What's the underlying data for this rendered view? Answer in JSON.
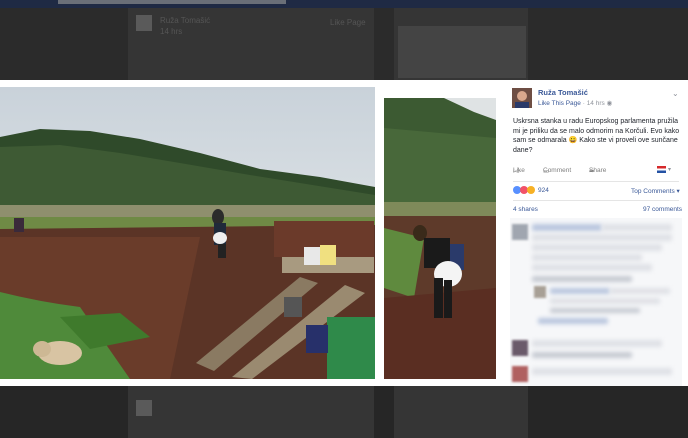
{
  "background": {
    "post_author": "Ruža Tomašić",
    "post_action": "Like Page",
    "post_time": "14 hrs"
  },
  "post": {
    "author": "Ruža Tomašić",
    "like_page": "Like This Page",
    "time": "14 hrs",
    "text": "Uskrsna stanka u radu Europskog parlamenta pružila mi je priliku da se malo odmorim na Korčuli. Evo kako sam se odmarala 😀 Kako ste vi proveli ove sunčane dane?",
    "actions": {
      "like": "Like",
      "comment": "Comment",
      "share": "Share"
    },
    "reactions_count": "924",
    "top_comments": "Top Comments",
    "shares": "4 shares",
    "comments": "97 comments"
  },
  "colors": {
    "link": "#3b5998",
    "overlay": "#1e1e1e"
  },
  "icons": [
    "globe-icon",
    "chevron-down-icon",
    "like-icon",
    "comment-icon",
    "share-icon",
    "flag-icon",
    "love-reaction-icon",
    "wow-reaction-icon"
  ]
}
